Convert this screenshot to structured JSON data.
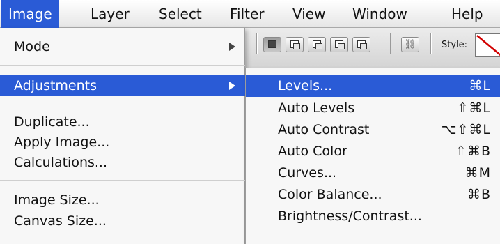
{
  "menubar": {
    "items": [
      {
        "label": "Image",
        "active": true
      },
      {
        "label": "Layer"
      },
      {
        "label": "Select"
      },
      {
        "label": "Filter"
      },
      {
        "label": "View"
      },
      {
        "label": "Window"
      },
      {
        "label": "Help"
      }
    ]
  },
  "toolbar": {
    "style_label": "Style:"
  },
  "image_menu": {
    "items": [
      {
        "label": "Mode",
        "submenu": true
      },
      {
        "label": "Adjustments",
        "submenu": true,
        "highlighted": true
      },
      {
        "label": "Duplicate..."
      },
      {
        "label": "Apply Image..."
      },
      {
        "label": "Calculations..."
      },
      {
        "label": "Image Size..."
      },
      {
        "label": "Canvas Size..."
      }
    ]
  },
  "adjustments_submenu": {
    "items": [
      {
        "label": "Levels...",
        "shortcut": "⌘L",
        "highlighted": true
      },
      {
        "label": "Auto Levels",
        "shortcut": "⇧⌘L"
      },
      {
        "label": "Auto Contrast",
        "shortcut": "⌥⇧⌘L"
      },
      {
        "label": "Auto Color",
        "shortcut": "⇧⌘B"
      },
      {
        "label": "Curves...",
        "shortcut": "⌘M"
      },
      {
        "label": "Color Balance...",
        "shortcut": "⌘B"
      },
      {
        "label": "Brightness/Contrast...",
        "shortcut": ""
      }
    ]
  },
  "colors": {
    "highlight": "#2a5bd6",
    "menu_bg": "#f7f7f7"
  }
}
